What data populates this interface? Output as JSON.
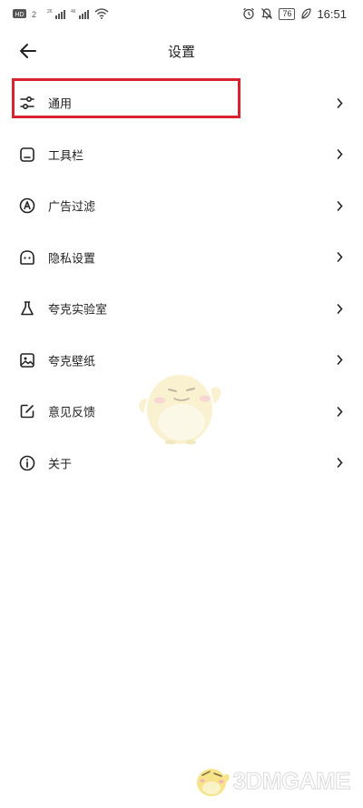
{
  "status_bar": {
    "network_labels": [
      "HD",
      "2",
      "26",
      "46"
    ],
    "battery": "76",
    "time": "16:51"
  },
  "header": {
    "title": "设置"
  },
  "settings": {
    "items": [
      {
        "label": "通用",
        "icon": "sliders-icon"
      },
      {
        "label": "工具栏",
        "icon": "toolbar-icon"
      },
      {
        "label": "广告过滤",
        "icon": "ad-filter-icon"
      },
      {
        "label": "隐私设置",
        "icon": "privacy-icon"
      },
      {
        "label": "夸克实验室",
        "icon": "flask-icon"
      },
      {
        "label": "夸克壁纸",
        "icon": "image-icon"
      },
      {
        "label": "意见反馈",
        "icon": "edit-icon"
      },
      {
        "label": "关于",
        "icon": "info-icon"
      }
    ]
  },
  "highlight": {
    "target": "通用",
    "color": "#d9232e"
  },
  "watermark": {
    "text": "3DMGAME"
  }
}
